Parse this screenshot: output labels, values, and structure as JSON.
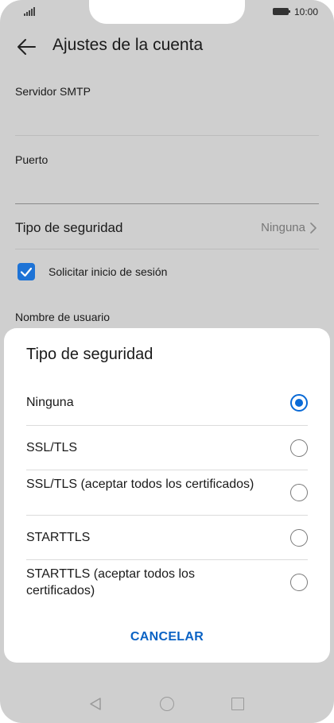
{
  "status_bar": {
    "time": "10:00"
  },
  "header": {
    "title": "Ajustes de la cuenta"
  },
  "settings": {
    "smtp_server_label": "Servidor SMTP",
    "port_label": "Puerto",
    "security_type_label": "Tipo de seguridad",
    "security_type_value": "Ninguna",
    "require_login_label": "Solicitar inicio de sesión",
    "require_login_checked": true,
    "username_label": "Nombre de usuario"
  },
  "dialog": {
    "title": "Tipo de seguridad",
    "options": [
      {
        "label": "Ninguna",
        "selected": true
      },
      {
        "label": "SSL/TLS",
        "selected": false
      },
      {
        "label": "SSL/TLS (aceptar todos los certificados)",
        "selected": false
      },
      {
        "label": "STARTTLS",
        "selected": false
      },
      {
        "label": "STARTTLS (aceptar todos los certificados)",
        "selected": false
      }
    ],
    "cancel_label": "CANCELAR"
  },
  "colors": {
    "accent": "#0a6ad6",
    "checkbox": "#1e73d6",
    "scrim": "#cfcfcf"
  }
}
